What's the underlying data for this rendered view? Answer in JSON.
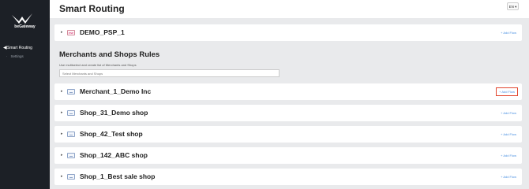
{
  "sidebar": {
    "brand": "beGateway",
    "nav": [
      {
        "label": "Smart Routing",
        "icon": "arrow-left-icon",
        "active": true
      },
      {
        "label": "Settings",
        "icon": "bullet-icon"
      }
    ]
  },
  "header": {
    "title": "Smart Routing",
    "language": "EN"
  },
  "psp": {
    "name": "DEMO_PSP_1",
    "add_flow": "+ Add Flow"
  },
  "section": {
    "title": "Merchants and Shops Rules",
    "subtitle": "Use multiselect and create list of Merchants and Shops",
    "select_placeholder": "Select Merchants and Shops"
  },
  "rows": [
    {
      "name": "Merchant_1_Demo Inc",
      "add_flow": "+ Add Flow",
      "highlighted": true
    },
    {
      "name": "Shop_31_Demo shop",
      "add_flow": "+ Add Flow"
    },
    {
      "name": "Shop_42_Test shop",
      "add_flow": "+ Add Flow"
    },
    {
      "name": "Shop_142_ABC shop",
      "add_flow": "+ Add Flow"
    },
    {
      "name": "Shop_1_Best sale shop",
      "add_flow": "+ Add Flow"
    }
  ],
  "colors": {
    "sidebar_bg": "#1c2026",
    "accent_link": "#4a90e2",
    "highlight_border": "#e2462f"
  }
}
